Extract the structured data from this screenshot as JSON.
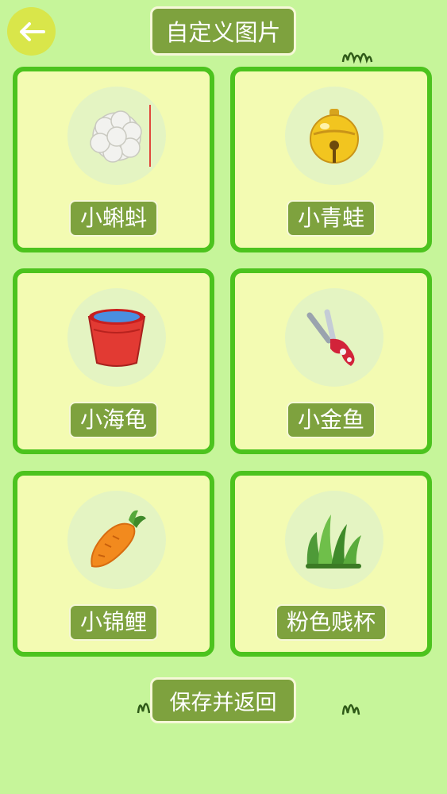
{
  "header": {
    "title": "自定义图片"
  },
  "items": [
    {
      "label": "小蝌蚪",
      "icon": "cotton-ball-icon"
    },
    {
      "label": "小青蛙",
      "icon": "bell-icon"
    },
    {
      "label": "小海龟",
      "icon": "bucket-icon"
    },
    {
      "label": "小金鱼",
      "icon": "scissors-icon"
    },
    {
      "label": "小锦鲤",
      "icon": "carrot-icon"
    },
    {
      "label": "粉色贱杯",
      "icon": "grass-icon"
    }
  ],
  "footer": {
    "save_label": "保存并返回"
  },
  "colors": {
    "background": "#c6f59a",
    "card_border": "#4cc31e",
    "card_fill": "#f3fbb2",
    "label_bg": "#7ea23e"
  }
}
